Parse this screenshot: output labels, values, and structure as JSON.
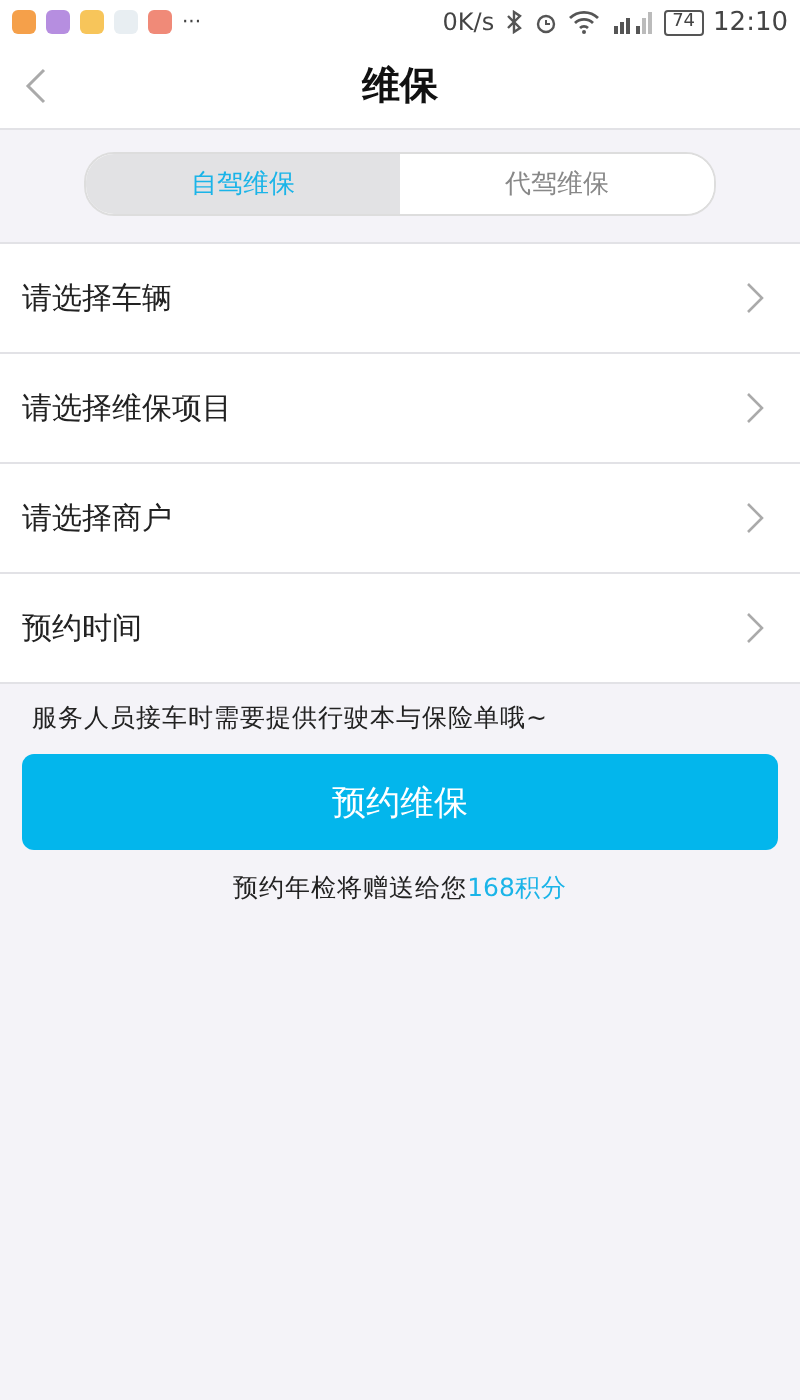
{
  "status_bar": {
    "app_icons": [
      {
        "color": "#f5a04a"
      },
      {
        "color": "#b68ee0"
      },
      {
        "color": "#f7c55a"
      },
      {
        "color": "#e8eef2"
      },
      {
        "color": "#f08a78"
      }
    ],
    "more": "···",
    "speed": "0K/s",
    "battery": "74",
    "time": "12:10"
  },
  "header": {
    "title": "维保"
  },
  "tabs": [
    {
      "label": "自驾维保",
      "selected": true
    },
    {
      "label": "代驾维保",
      "selected": false
    }
  ],
  "menu_items": [
    "请选择车辆",
    "请选择维保项目",
    "请选择商户",
    "预约时间"
  ],
  "notice": "服务人员接车时需要提供行驶本与保险单哦~",
  "submit_button": "预约维保",
  "reward": {
    "text": "预约年检将赠送给您",
    "points": "168积分"
  }
}
